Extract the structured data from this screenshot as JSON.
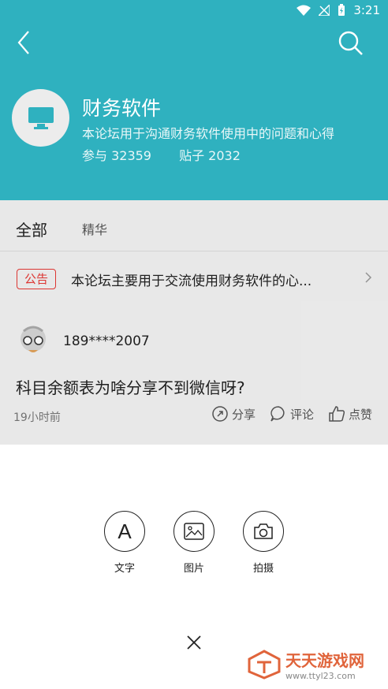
{
  "status": {
    "time": "3:21"
  },
  "forum": {
    "title": "财务软件",
    "description": "本论坛用于沟通财务软件使用中的问题和心得",
    "participants_label": "参与 32359",
    "posts_label": "贴子 2032"
  },
  "tabs": {
    "all": "全部",
    "featured": "精华"
  },
  "notice": {
    "badge": "公告",
    "text": "本论坛主要用于交流使用财务软件的心..."
  },
  "post": {
    "username": "189****2007",
    "title": "科目余额表为啥分享不到微信呀?",
    "time": "19小时前",
    "share": "分享",
    "comment": "评论",
    "like": "点赞"
  },
  "sheet": {
    "text": "文字",
    "image": "图片",
    "camera": "拍摄"
  },
  "watermark": {
    "name": "天天游戏网",
    "url": "www.ttyl23.com"
  },
  "colors": {
    "header": "#2fb1bf",
    "badge": "#e53935",
    "watermark": "#e0643b"
  }
}
